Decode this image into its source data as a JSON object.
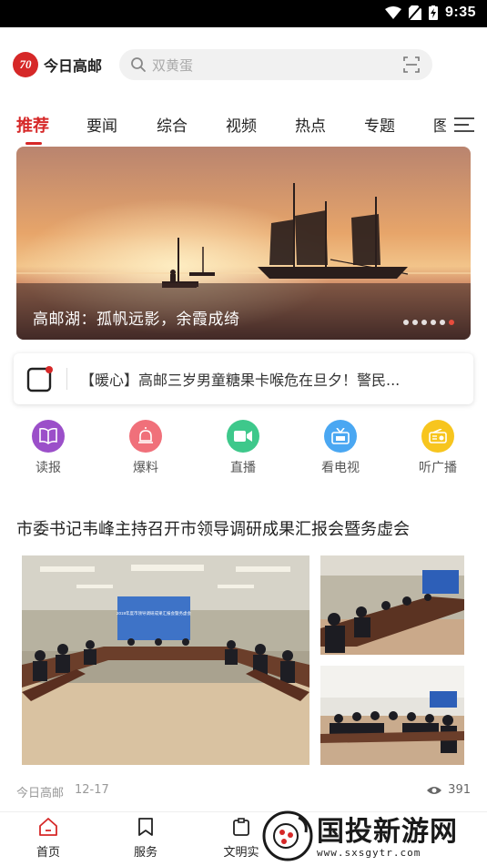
{
  "status_bar": {
    "time": "9:35"
  },
  "header": {
    "logo_mark": "70",
    "logo_text": "今日高邮",
    "search_placeholder": "双黄蛋"
  },
  "tabs": [
    {
      "label": "推荐",
      "active": true
    },
    {
      "label": "要闻"
    },
    {
      "label": "综合"
    },
    {
      "label": "视频"
    },
    {
      "label": "热点"
    },
    {
      "label": "专题"
    },
    {
      "label": "图"
    }
  ],
  "banner": {
    "caption": "高邮湖：孤帆远影，余霞成绮",
    "dot_count": 6,
    "active_dot": 5
  },
  "notice": {
    "text": "【暖心】高邮三岁男童糖果卡喉危在旦夕！警民..."
  },
  "quick_links": [
    {
      "label": "读报",
      "icon": "book-icon",
      "color": "#9b4fc9"
    },
    {
      "label": "爆料",
      "icon": "alarm-icon",
      "color": "#f0707a"
    },
    {
      "label": "直播",
      "icon": "video-camera-icon",
      "color": "#3ec88b"
    },
    {
      "label": "看电视",
      "icon": "tv-icon",
      "color": "#4aa7f2"
    },
    {
      "label": "听广播",
      "icon": "radio-icon",
      "color": "#f7c51e"
    }
  ],
  "article": {
    "title": "市委书记韦峰主持召开市领导调研成果汇报会暨务虚会",
    "source": "今日高邮",
    "date": "12-17",
    "views": "391",
    "screen_text": "2019年度市领导调研成果汇报会暨务虚会"
  },
  "bottom_nav": [
    {
      "label": "首页",
      "icon": "home-icon",
      "active": true
    },
    {
      "label": "服务",
      "icon": "bookmark-icon"
    },
    {
      "label": "文明实",
      "icon": "clipboard-icon"
    }
  ],
  "watermark": {
    "text": "国投新游网",
    "url": "www.sxsgytr.com"
  },
  "colors": {
    "accent": "#d62828"
  }
}
